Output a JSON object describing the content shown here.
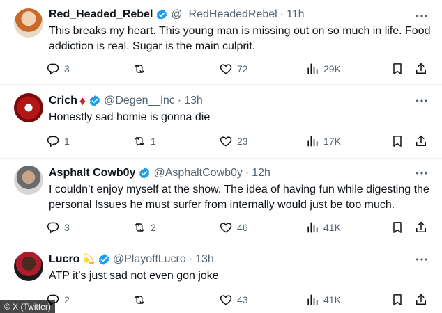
{
  "colors": {
    "verified": "#1d9bf0",
    "muted": "#536471",
    "text": "#0f1419",
    "divider": "#eff3f4"
  },
  "tweets": [
    {
      "name": "Red_Headed_Rebel",
      "handle": "@_RedHeadedRebel",
      "separator": "·",
      "time": "11h",
      "text": "This breaks my heart. This young man is missing out on so much in life. Food addiction is real. Sugar is the main culprit.",
      "replies": "3",
      "retweets": "",
      "likes": "72",
      "views": "29K"
    },
    {
      "name": "Crich",
      "name_emoji": "♦",
      "handle": "@Degen__inc",
      "separator": "·",
      "time": "13h",
      "text": "Honestly sad homie is gonna die",
      "replies": "1",
      "retweets": "1",
      "likes": "23",
      "views": "17K"
    },
    {
      "name": "Asphalt Cowb0y",
      "handle": "@AsphaltCowb0y",
      "separator": "·",
      "time": "12h",
      "text": "I couldn’t enjoy myself at the show.  The idea of having fun while digesting the personal Issues he must surfer from internally would just be too much.",
      "replies": "3",
      "retweets": "2",
      "likes": "46",
      "views": "41K"
    },
    {
      "name": "Lucro",
      "name_emoji": "💫",
      "handle": "@PlayoffLucro",
      "separator": "·",
      "time": "13h",
      "text": "ATP it’s just sad not even gon joke",
      "replies": "2",
      "retweets": "",
      "likes": "43",
      "views": "41K"
    }
  ],
  "watermark": "© X (Twitter)"
}
